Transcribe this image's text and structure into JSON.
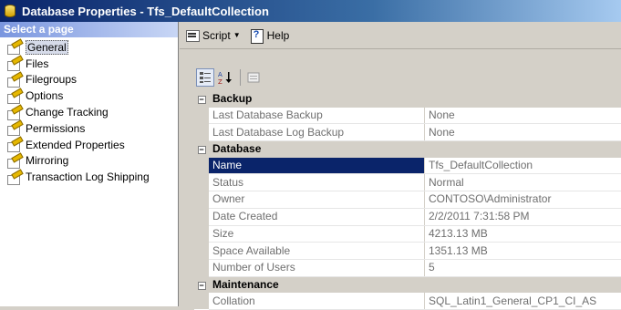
{
  "window": {
    "title": "Database Properties - Tfs_DefaultCollection"
  },
  "left_panel": {
    "header": "Select a page",
    "items": [
      {
        "label": "General",
        "selected": true
      },
      {
        "label": "Files"
      },
      {
        "label": "Filegroups"
      },
      {
        "label": "Options"
      },
      {
        "label": "Change Tracking"
      },
      {
        "label": "Permissions"
      },
      {
        "label": "Extended Properties"
      },
      {
        "label": "Mirroring"
      },
      {
        "label": "Transaction Log Shipping"
      }
    ]
  },
  "toolbar": {
    "script_label": "Script",
    "help_label": "Help"
  },
  "property_grid": {
    "categories": [
      {
        "name": "Backup",
        "toggle": "−",
        "rows": [
          {
            "name": "Last Database Backup",
            "value": "None"
          },
          {
            "name": "Last Database Log Backup",
            "value": "None"
          }
        ]
      },
      {
        "name": "Database",
        "toggle": "−",
        "rows": [
          {
            "name": "Name",
            "value": "Tfs_DefaultCollection",
            "selected": true
          },
          {
            "name": "Status",
            "value": "Normal"
          },
          {
            "name": "Owner",
            "value": "CONTOSO\\Administrator"
          },
          {
            "name": "Date Created",
            "value": "2/2/2011 7:31:58 PM"
          },
          {
            "name": "Size",
            "value": "4213.13 MB"
          },
          {
            "name": "Space Available",
            "value": "1351.13 MB"
          },
          {
            "name": "Number of Users",
            "value": "5"
          }
        ]
      },
      {
        "name": "Maintenance",
        "toggle": "−",
        "rows": [
          {
            "name": "Collation",
            "value": "SQL_Latin1_General_CP1_CI_AS"
          }
        ]
      }
    ]
  },
  "colors": {
    "selection": "#0a246a",
    "title_start": "#0a246a",
    "title_end": "#a6caf0"
  },
  "icons": {
    "title": "database-icon",
    "nav": "property-page-icon",
    "script": "script-icon",
    "help": "help-icon",
    "categorized": "categorized-icon",
    "alphabetical": "alphabetical-sort-icon",
    "property_pages": "property-pages-icon"
  }
}
